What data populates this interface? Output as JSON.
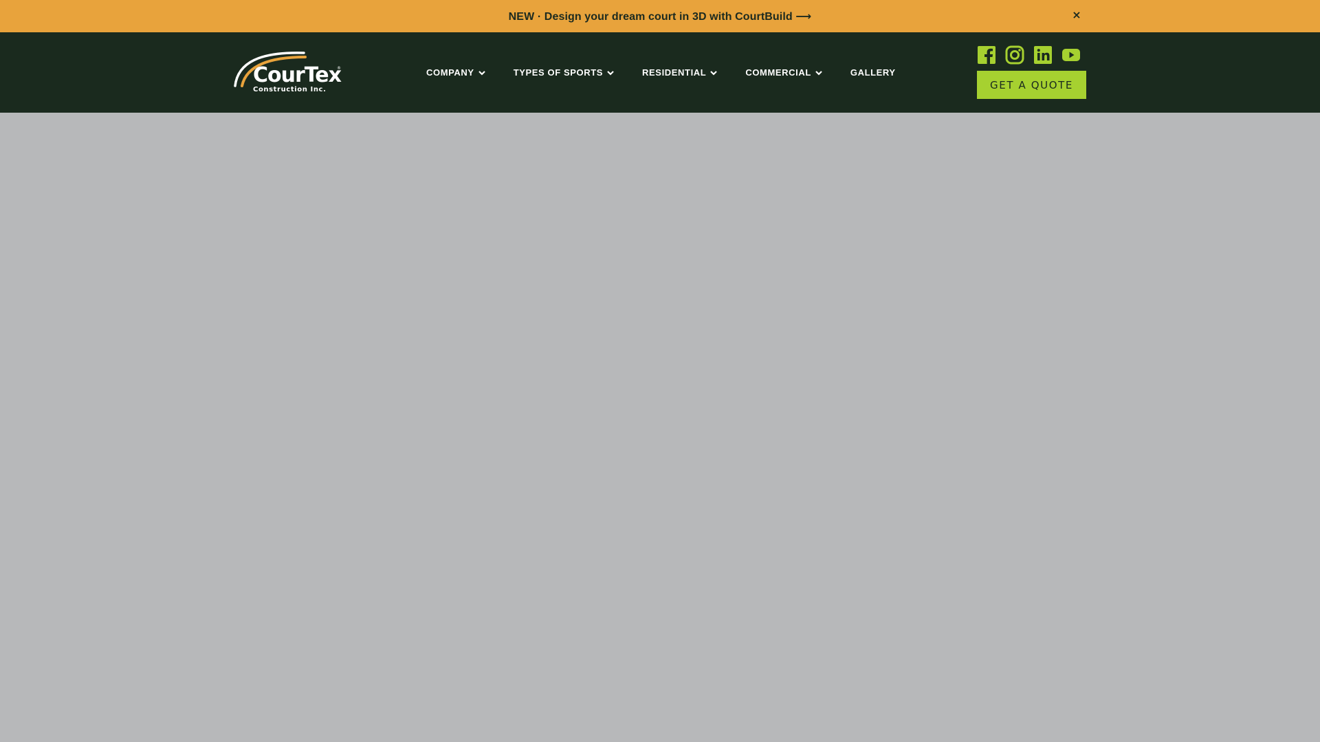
{
  "announcement": {
    "text": "NEW · Design your dream court in 3D with CourtBuild ⟶",
    "close": "×"
  },
  "logo": {
    "name": "CourTex",
    "registered": "®",
    "tagline": "Construction Inc."
  },
  "nav": {
    "items": [
      {
        "label": "COMPANY",
        "dropdown": true
      },
      {
        "label": "TYPES OF SPORTS",
        "dropdown": true
      },
      {
        "label": "RESIDENTIAL",
        "dropdown": true
      },
      {
        "label": "COMMERCIAL",
        "dropdown": true
      },
      {
        "label": "GALLERY",
        "dropdown": false
      }
    ]
  },
  "social": [
    "facebook-icon",
    "instagram-icon",
    "linkedin-icon",
    "youtube-icon"
  ],
  "cta": {
    "label": "GET A QUOTE"
  },
  "colors": {
    "announcement_bg": "#e8a33c",
    "header_bg": "#1a2a1e",
    "accent": "#a6d130",
    "hero_bg": "#b7b8ba"
  }
}
